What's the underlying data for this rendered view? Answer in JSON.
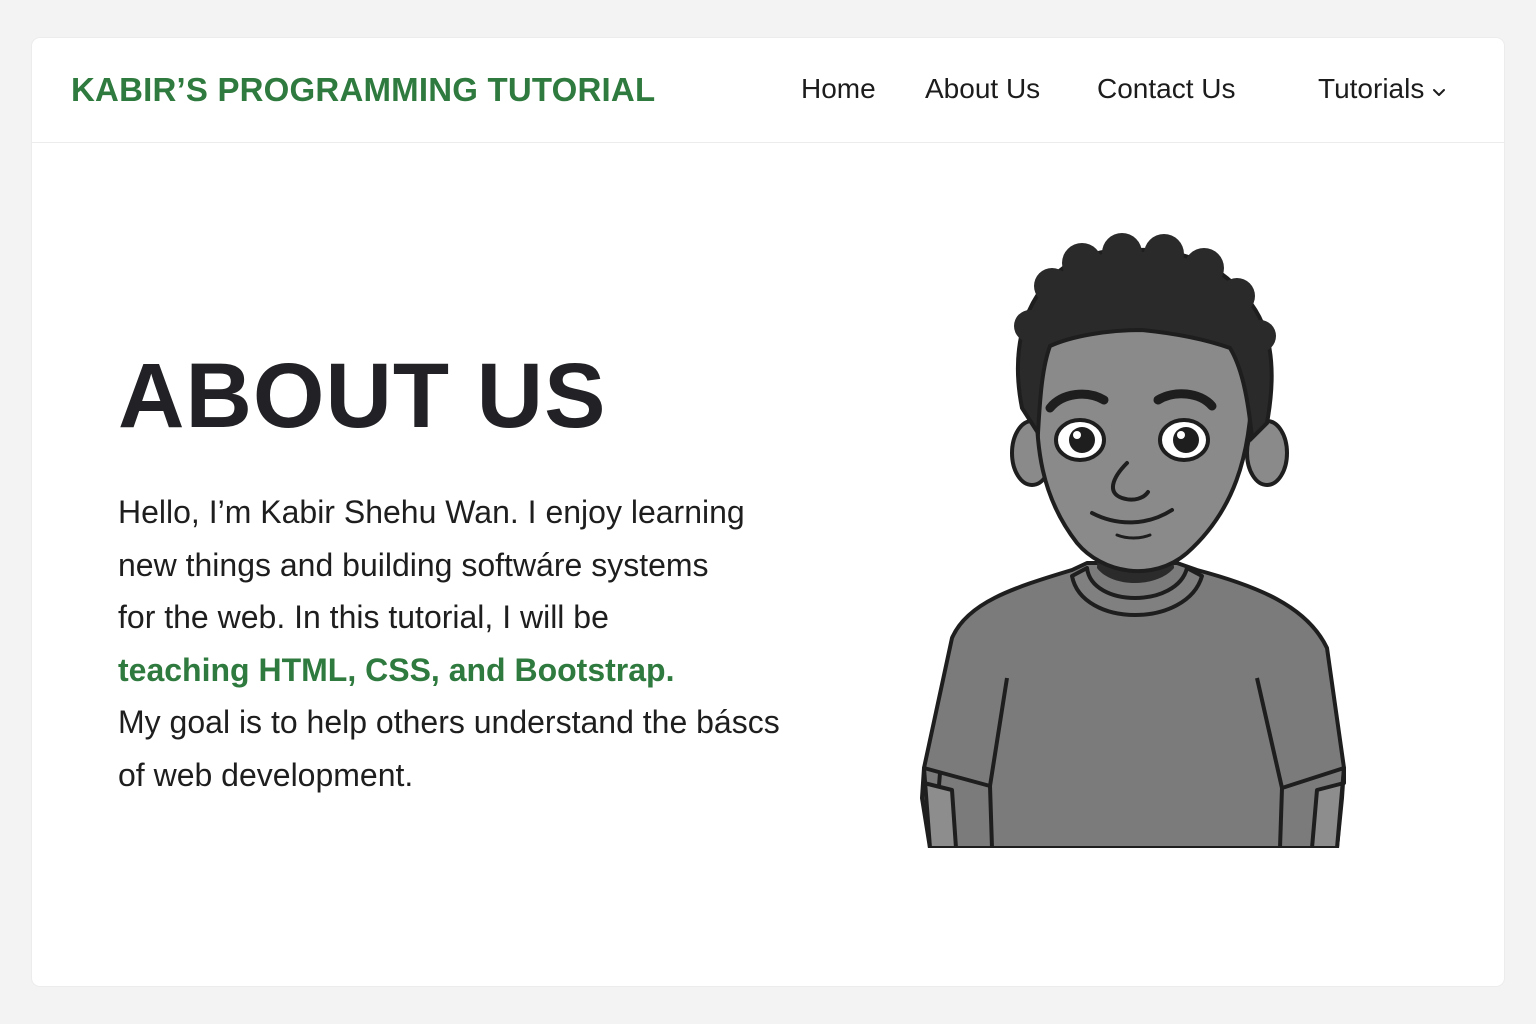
{
  "navbar": {
    "brand": "KABIR’S PROGRAMMING TUTORIAL",
    "links": [
      {
        "label": "Home"
      },
      {
        "label": "About Us"
      },
      {
        "label": "Contact Us"
      }
    ],
    "dropdown": {
      "label": "Tutorials",
      "icon": "chevron-down-icon"
    }
  },
  "hero": {
    "title": "ABOUT US",
    "lines": [
      "Hello, I’m Kabir Shehu Wan. I enjoy learning",
      "new things and building softwáre systems",
      "for the web. In this tutorial, I will be",
      "teaching HTML, CSS, and Bootstrap.",
      "My goal is to help others understand the báscs",
      "of web development."
    ],
    "highlight_line_index": 3
  },
  "portrait": {
    "icon": "person-illustration"
  },
  "colors": {
    "brand_green": "#2f7a3e",
    "heading": "#222226",
    "text": "#1e1e1e",
    "background": "#f3f3f3",
    "card": "#ffffff"
  }
}
